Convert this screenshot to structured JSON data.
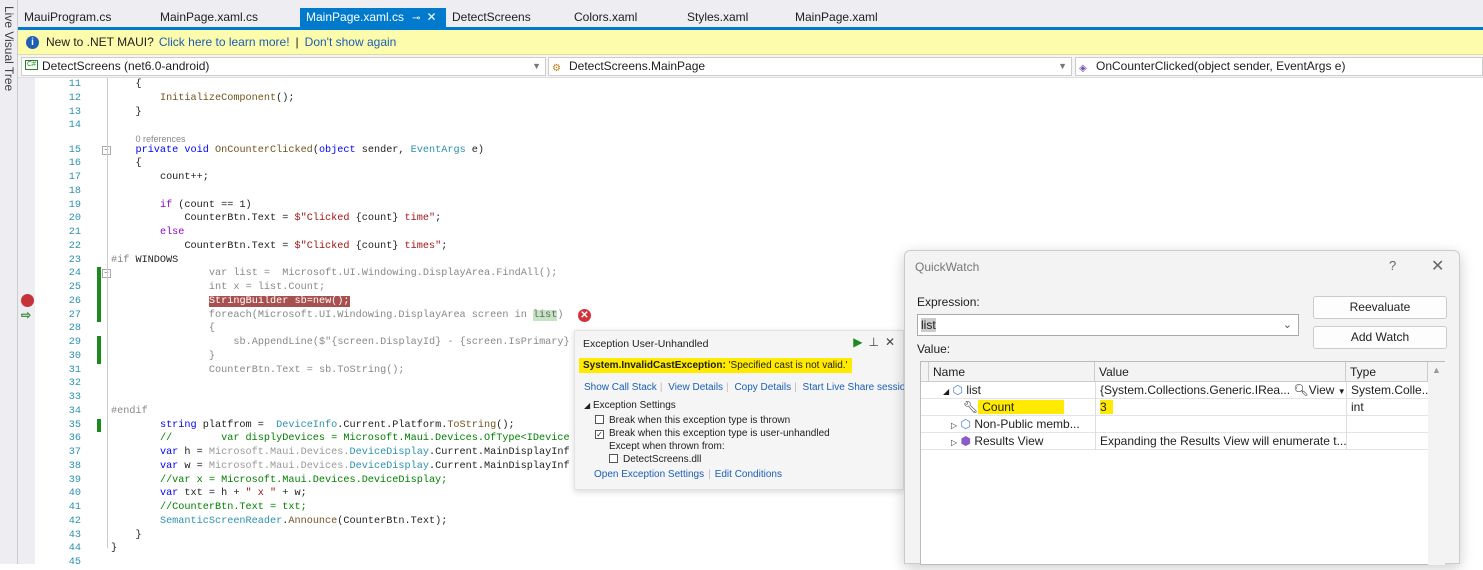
{
  "side_panel": "Live Visual Tree",
  "tabs": [
    {
      "label": "MauiProgram.cs"
    },
    {
      "label": "MainPage.xaml.cs"
    },
    {
      "label": "MainPage.xaml.cs",
      "active": true
    },
    {
      "label": "DetectScreens"
    },
    {
      "label": "Colors.xaml"
    },
    {
      "label": "Styles.xaml"
    },
    {
      "label": "MainPage.xaml"
    }
  ],
  "info": {
    "text": "New to .NET MAUI?",
    "link1": "Click here to learn more!",
    "sep": "|",
    "link2": "Don't show again"
  },
  "nav": {
    "project": "DetectScreens (net6.0-android)",
    "type": "DetectScreens.MainPage",
    "member": "OnCounterClicked(object sender, EventArgs e)"
  },
  "code": {
    "lens": "0 references",
    "lines": [
      {
        "n": "11",
        "i": 4,
        "tk": [
          [
            "",
            "{"
          ]
        ]
      },
      {
        "n": "12",
        "i": 8,
        "tk": [
          [
            "m",
            "InitializeComponent"
          ],
          [
            "",
            "();"
          ]
        ]
      },
      {
        "n": "13",
        "i": 4,
        "tk": [
          [
            "",
            "}"
          ]
        ]
      },
      {
        "n": "14",
        "i": 0,
        "tk": []
      },
      {
        "n": "15",
        "i": 4,
        "tk": [
          [
            "k",
            "private"
          ],
          [
            "",
            " "
          ],
          [
            "k",
            "void"
          ],
          [
            "",
            " "
          ],
          [
            "m",
            "OnCounterClicked"
          ],
          [
            "",
            "("
          ],
          [
            "k",
            "object"
          ],
          [
            "",
            " sender, "
          ],
          [
            "t",
            "EventArgs"
          ],
          [
            "",
            " e)"
          ]
        ]
      },
      {
        "n": "16",
        "i": 4,
        "tk": [
          [
            "",
            "{"
          ]
        ]
      },
      {
        "n": "17",
        "i": 8,
        "tk": [
          [
            "",
            "count++;"
          ]
        ]
      },
      {
        "n": "18",
        "i": 0,
        "tk": []
      },
      {
        "n": "19",
        "i": 8,
        "tk": [
          [
            "p",
            "if"
          ],
          [
            "",
            " (count == 1)"
          ]
        ]
      },
      {
        "n": "20",
        "i": 12,
        "tk": [
          [
            "",
            "CounterBtn.Text = "
          ],
          [
            "s",
            "$\"Clicked "
          ],
          [
            "",
            "{count}"
          ],
          [
            "s",
            " time\""
          ],
          [
            "",
            ";"
          ]
        ]
      },
      {
        "n": "21",
        "i": 8,
        "tk": [
          [
            "p",
            "else"
          ]
        ]
      },
      {
        "n": "22",
        "i": 12,
        "tk": [
          [
            "",
            "CounterBtn.Text = "
          ],
          [
            "s",
            "$\"Clicked "
          ],
          [
            "",
            "{count}"
          ],
          [
            "s",
            " times\""
          ],
          [
            "",
            ";"
          ]
        ]
      },
      {
        "n": "23",
        "i": 0,
        "tk": [
          [
            "pp",
            "#if"
          ],
          [
            "",
            " WINDOWS"
          ]
        ]
      },
      {
        "n": "24",
        "i": 16,
        "tk": [
          [
            "g",
            "var list =  Microsoft.UI.Windowing.DisplayArea.FindAll();"
          ]
        ]
      },
      {
        "n": "25",
        "i": 16,
        "tk": [
          [
            "g",
            "int x = list.Count;"
          ]
        ]
      },
      {
        "n": "26",
        "i": 16,
        "tk": [
          [
            "hl",
            "StringBuilder sb=new();"
          ]
        ]
      },
      {
        "n": "27",
        "i": 16,
        "tk": [
          [
            "g",
            "foreach(Microsoft.UI.Windowing.DisplayArea screen in "
          ],
          [
            "gh",
            "list"
          ],
          [
            "g",
            ")"
          ]
        ]
      },
      {
        "n": "28",
        "i": 16,
        "tk": [
          [
            "g",
            "{"
          ]
        ]
      },
      {
        "n": "29",
        "i": 20,
        "tk": [
          [
            "g",
            "sb.AppendLine($\"{screen.DisplayId} - {screen.IsPrimary}"
          ]
        ]
      },
      {
        "n": "30",
        "i": 16,
        "tk": [
          [
            "g",
            "}"
          ]
        ]
      },
      {
        "n": "31",
        "i": 16,
        "tk": [
          [
            "g",
            "CounterBtn.Text = sb.ToString();"
          ]
        ]
      },
      {
        "n": "32",
        "i": 0,
        "tk": []
      },
      {
        "n": "33",
        "i": 0,
        "tk": []
      },
      {
        "n": "34",
        "i": 0,
        "tk": [
          [
            "g",
            "#endif"
          ]
        ]
      },
      {
        "n": "35",
        "i": 8,
        "tk": [
          [
            "k",
            "string"
          ],
          [
            "",
            " platfrom =  "
          ],
          [
            "t",
            "DeviceInfo"
          ],
          [
            "",
            ".Current.Platform."
          ],
          [
            "m",
            "ToString"
          ],
          [
            "",
            "();"
          ]
        ]
      },
      {
        "n": "36",
        "i": 8,
        "tk": [
          [
            "c",
            "//        var displyDevices = Microsoft.Maui.Devices.OfType<IDevice"
          ]
        ]
      },
      {
        "n": "37",
        "i": 8,
        "tk": [
          [
            "k",
            "var"
          ],
          [
            "",
            " h = "
          ],
          [
            "d",
            "Microsoft.Maui.Devices."
          ],
          [
            "t",
            "DeviceDisplay"
          ],
          [
            "",
            ".Current.MainDisplayInf"
          ]
        ]
      },
      {
        "n": "38",
        "i": 8,
        "tk": [
          [
            "k",
            "var"
          ],
          [
            "",
            " w = "
          ],
          [
            "d",
            "Microsoft.Maui.Devices."
          ],
          [
            "t",
            "DeviceDisplay"
          ],
          [
            "",
            ".Current.MainDisplayInf"
          ]
        ]
      },
      {
        "n": "39",
        "i": 8,
        "tk": [
          [
            "c",
            "//var x = Microsoft.Maui.Devices.DeviceDisplay;"
          ]
        ]
      },
      {
        "n": "40",
        "i": 8,
        "tk": [
          [
            "k",
            "var"
          ],
          [
            "",
            " txt = h + "
          ],
          [
            "s",
            "\" x \""
          ],
          [
            "",
            " + w;"
          ]
        ]
      },
      {
        "n": "41",
        "i": 8,
        "tk": [
          [
            "c",
            "//CounterBtn.Text = txt;"
          ]
        ]
      },
      {
        "n": "42",
        "i": 8,
        "tk": [
          [
            "t",
            "SemanticScreenReader"
          ],
          [
            "",
            "."
          ],
          [
            "m",
            "Announce"
          ],
          [
            "",
            "(CounterBtn.Text);"
          ]
        ]
      },
      {
        "n": "43",
        "i": 4,
        "tk": [
          [
            "",
            "}"
          ]
        ]
      },
      {
        "n": "44",
        "i": 0,
        "tk": [
          [
            "",
            "}"
          ]
        ]
      },
      {
        "n": "45",
        "i": 0,
        "tk": []
      }
    ]
  },
  "exception": {
    "title": "Exception User-Unhandled",
    "type": "System.InvalidCastException:",
    "message": "'Specified cast is not valid.'",
    "links": [
      "Show Call Stack",
      "View Details",
      "Copy Details",
      "Start Live Share session"
    ],
    "settings_title": "Exception Settings",
    "opt_thrown": "Break when this exception type is thrown",
    "opt_unhandled": "Break when this exception type is user-unhandled",
    "except_label": "Except when thrown from:",
    "module": "DetectScreens.dll",
    "open_settings": "Open Exception Settings",
    "edit_conditions": "Edit Conditions"
  },
  "quickwatch": {
    "title": "QuickWatch",
    "help": "?",
    "expression_label": "Expression:",
    "expression": "list",
    "value_label": "Value:",
    "reevaluate": "Reevaluate",
    "add_watch": "Add Watch",
    "columns": [
      "Name",
      "Value",
      "Type"
    ],
    "rows": [
      {
        "name": "list",
        "value": "{System.Collections.Generic.IRea...",
        "view": "View",
        "type": "System.Colle..."
      },
      {
        "name": "Count",
        "value": "3",
        "type": "int"
      },
      {
        "name": "Non-Public memb...",
        "value": "",
        "type": ""
      },
      {
        "name": "Results View",
        "value": "Expanding the Results View will enumerate t...",
        "type": ""
      }
    ]
  }
}
